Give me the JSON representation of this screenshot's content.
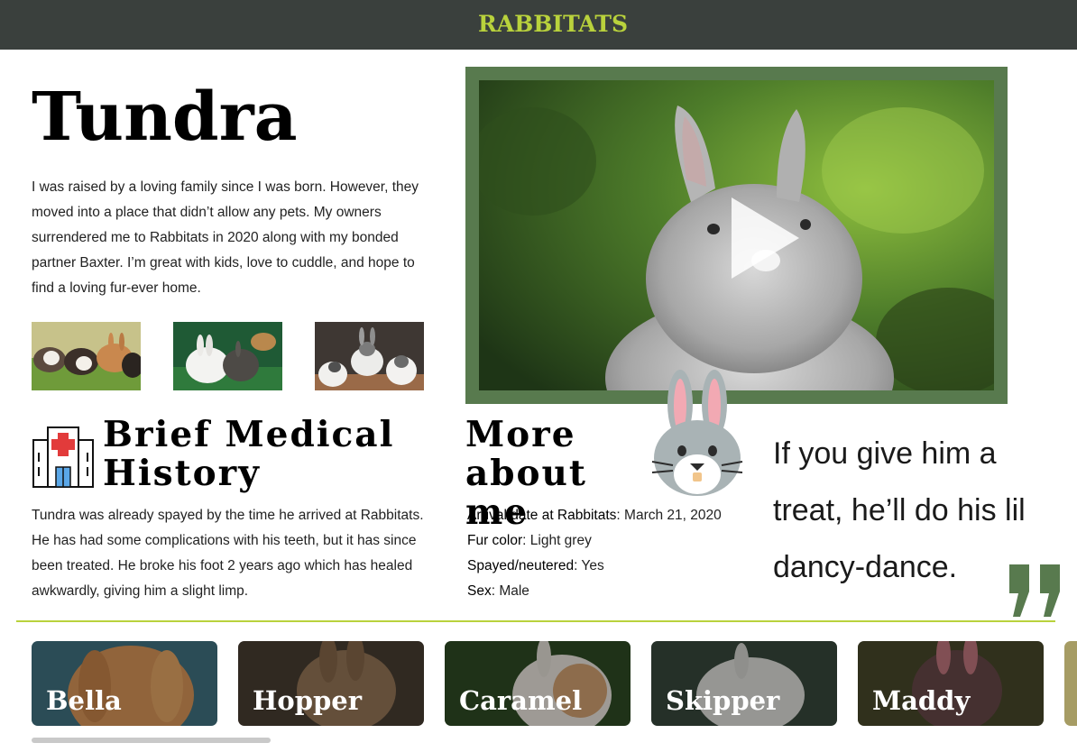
{
  "header": {
    "logo_text": "RABBITATS",
    "background": "#3a403d",
    "accent": "#b9d23c"
  },
  "rabbit": {
    "name": "Tundra",
    "bio": "I was raised by a loving family since I was born. However, they moved into a place that didn’t allow any pets. My owners surrendered me to Rabbitats in 2020 along with my bonded partner Baxter. I’m great with kids, love to cuddle, and hope to find a loving fur-ever home."
  },
  "gallery": {
    "thumbnails": [
      "rabbits-on-grass-photo",
      "rabbits-in-grass-photo",
      "rabbits-group-photo"
    ]
  },
  "video": {
    "frame_color": "#587a4e",
    "icon": "play-icon"
  },
  "medical": {
    "icon": "hospital-icon",
    "title": "Brief Medical History",
    "text": "Tundra was already spayed by the time he arrived at Rabbitats. He has had some complications with his teeth, but it has since been treated. He broke his foot 2 years ago which has healed awkwardly, giving him a slight limp."
  },
  "more_about": {
    "title": "More about me",
    "icon": "rabbit-face-icon",
    "facts": [
      {
        "key": "Arrival date at Rabbitats",
        "value": ": March 21, 2020"
      },
      {
        "key": "Fur color",
        "value": ": Light grey"
      },
      {
        "key": "Spayed/neutered",
        "value": ": Yes"
      },
      {
        "key": "Sex",
        "value": ": Male"
      }
    ]
  },
  "quote": {
    "text": "If you give him a treat, he’ll do his lil dancy-dance.",
    "mark_color": "#587a4e"
  },
  "other_rabbits": [
    {
      "name": "Bella"
    },
    {
      "name": "Hopper"
    },
    {
      "name": "Caramel"
    },
    {
      "name": "Skipper"
    },
    {
      "name": "Maddy"
    }
  ]
}
